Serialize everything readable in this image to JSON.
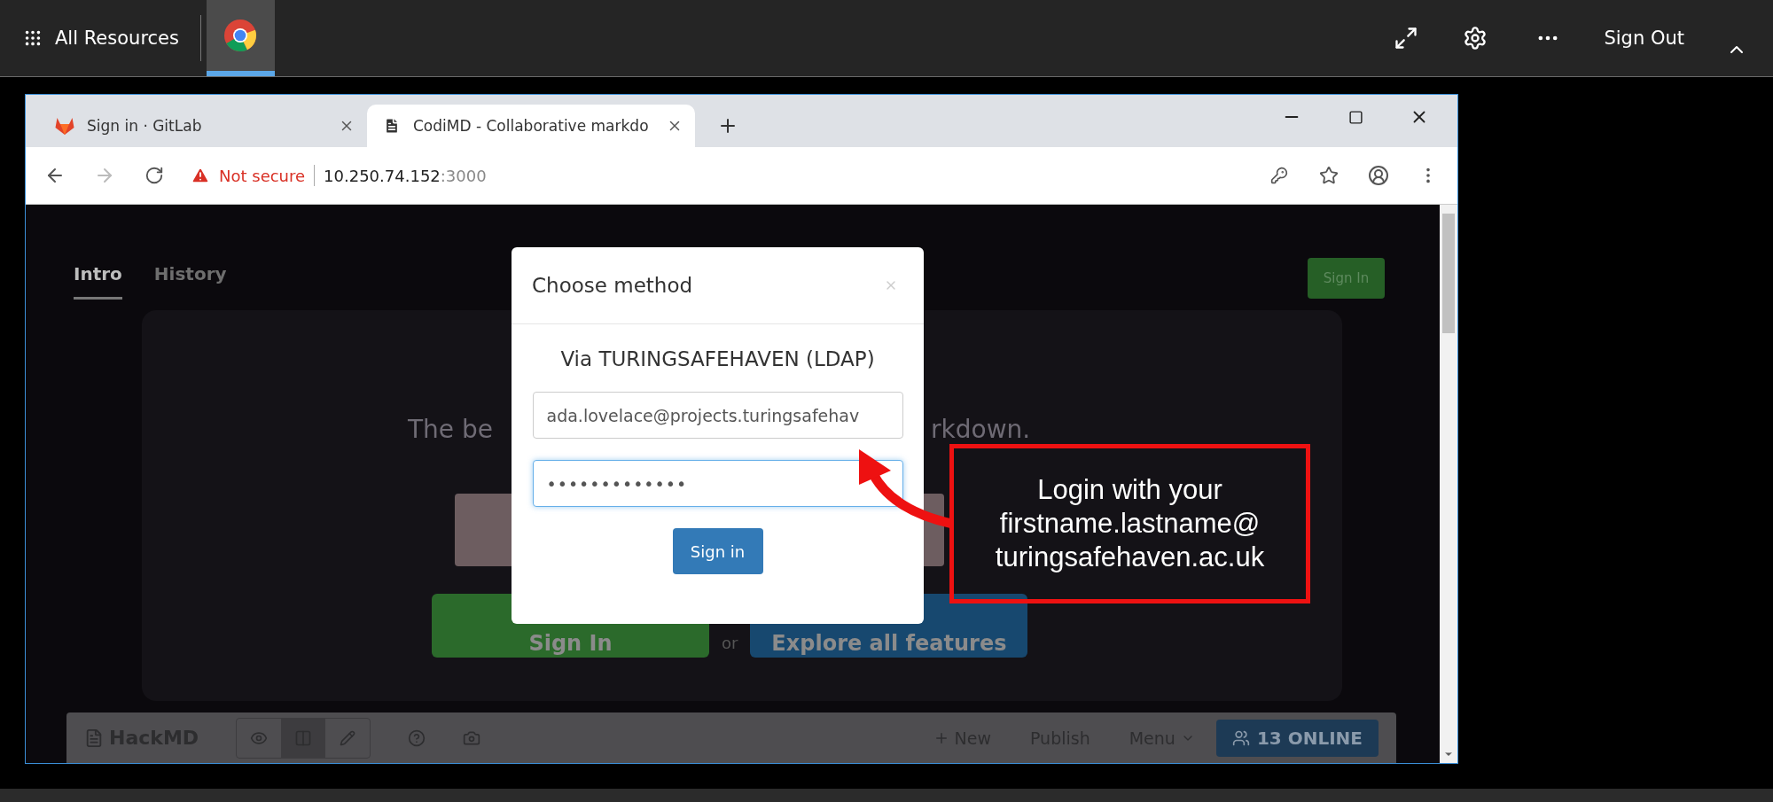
{
  "top_bar": {
    "app_menu_label": "All Resources",
    "running_apps": [
      {
        "kind": "chrome",
        "selected": true
      }
    ],
    "sign_out": "Sign Out"
  },
  "browser": {
    "tabs": [
      {
        "title": "Sign in · GitLab",
        "kind": "gitlab",
        "selected": false
      },
      {
        "title": "CodiMD - Collaborative markdo",
        "kind": "document",
        "selected": true
      }
    ],
    "address_bar": {
      "security": "Not secure",
      "host": "10.250.74.152",
      "port": ":3000"
    }
  },
  "page": {
    "nav_tabs": [
      {
        "label": "Intro",
        "selected": true
      },
      {
        "label": "History",
        "selected": false
      }
    ],
    "sign_in_button": "Sign In",
    "hero_text_left": "The be",
    "hero_text_right": "rkdown.",
    "primary_button": "Sign In",
    "or_text": "or",
    "explore_button": "Explore all features",
    "toolbar": {
      "brand": "HackMD",
      "view_modes": [
        {
          "kind": "view",
          "selected": false
        },
        {
          "kind": "split",
          "selected": true
        },
        {
          "kind": "edit",
          "selected": false
        }
      ],
      "new": "New",
      "publish": "Publish",
      "menu": "Menu",
      "online": "13 ONLINE"
    }
  },
  "modal": {
    "title": "Choose method",
    "provider": "Via TURINGSAFEHAVEN (LDAP)",
    "fields": [
      {
        "kind": "username",
        "value": "ada.lovelace@projects.turingsafehav",
        "focused": false
      },
      {
        "kind": "password",
        "value": "•••••••••••••",
        "focused": true
      }
    ],
    "submit": "Sign in"
  },
  "annotation": {
    "lines": [
      "Login with your",
      "firstname.lastname@",
      "turingsafehaven.ac.uk"
    ]
  }
}
